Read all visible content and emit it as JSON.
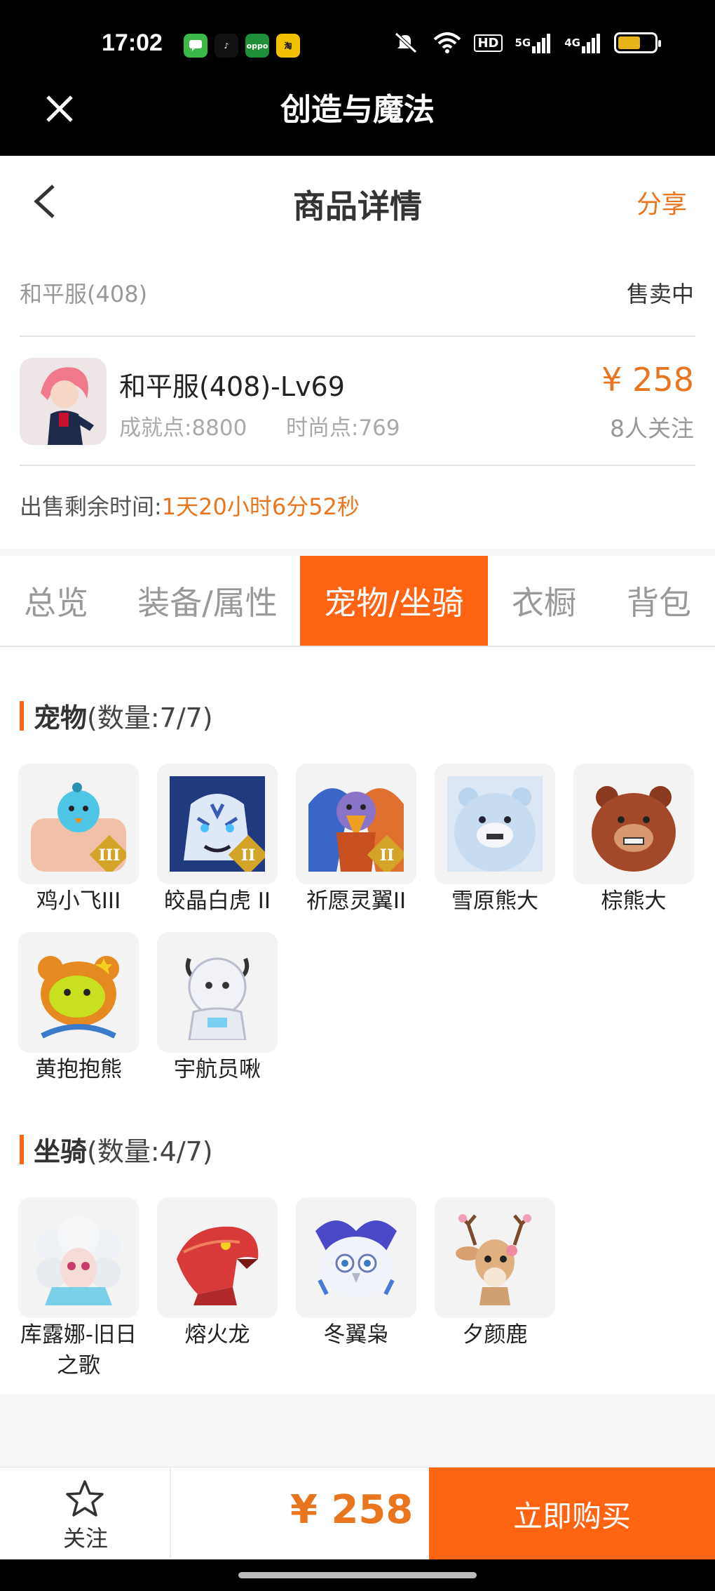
{
  "status_bar": {
    "time": "17:02",
    "apps": [
      {
        "name": "messages-app-icon",
        "label": "",
        "color": "#3cb84a"
      },
      {
        "name": "tiktok-app-icon",
        "label": "♪",
        "color": "#111111"
      },
      {
        "name": "oppo-app-icon",
        "label": "oppo",
        "color": "#1f8f3a"
      },
      {
        "name": "taobao-app-icon",
        "label": "淘",
        "color": "#f2c200"
      }
    ],
    "hd": "HD",
    "net1": "5G",
    "net2": "4G"
  },
  "app": {
    "title": "创造与魔法"
  },
  "header": {
    "title": "商品详情",
    "share": "分享"
  },
  "listing": {
    "server": "和平服(408)",
    "status": "售卖中",
    "role_name": "和平服(408)-Lv69",
    "achievement": "成就点:8800",
    "fashion": "时尚点:769",
    "price": "¥ 258",
    "followers": "8人关注",
    "remain_label": "出售剩余时间:",
    "remain_value": "1天20小时6分52秒"
  },
  "tabs": [
    {
      "label": "总览",
      "active": false
    },
    {
      "label": "装备/属性",
      "active": false
    },
    {
      "label": "宠物/坐骑",
      "active": true
    },
    {
      "label": "衣橱",
      "active": false
    },
    {
      "label": "背包",
      "active": false
    }
  ],
  "pets": {
    "title": "宠物",
    "count": "(数量:7/7)",
    "items": [
      {
        "name": "鸡小飞III",
        "icon": "chick-pet-icon",
        "badge": "III"
      },
      {
        "name": "皎晶白虎 II",
        "icon": "white-tiger-pet-icon",
        "badge": "II"
      },
      {
        "name": "祈愿灵翼II",
        "icon": "griffin-pet-icon",
        "badge": "II"
      },
      {
        "name": "雪原熊大",
        "icon": "snow-bear-pet-icon",
        "badge": ""
      },
      {
        "name": "棕熊大",
        "icon": "brown-bear-pet-icon",
        "badge": ""
      },
      {
        "name": "黄抱抱熊",
        "icon": "yellow-hug-bear-pet-icon",
        "badge": ""
      },
      {
        "name": "宇航员啾",
        "icon": "astronaut-pet-icon",
        "badge": ""
      }
    ]
  },
  "mounts": {
    "title": "坐骑",
    "count": "(数量:4/7)",
    "items": [
      {
        "name": "库露娜-旧日之歌",
        "icon": "sheep-girl-mount-icon"
      },
      {
        "name": "熔火龙",
        "icon": "lava-dragon-mount-icon"
      },
      {
        "name": "冬翼枭",
        "icon": "winter-owl-mount-icon"
      },
      {
        "name": "夕颜鹿",
        "icon": "deer-mount-icon"
      }
    ]
  },
  "bottom": {
    "follow": "关注",
    "price": "¥ 258",
    "buy": "立即购买"
  },
  "colors": {
    "accent": "#fe6411",
    "price": "#e9751e"
  }
}
